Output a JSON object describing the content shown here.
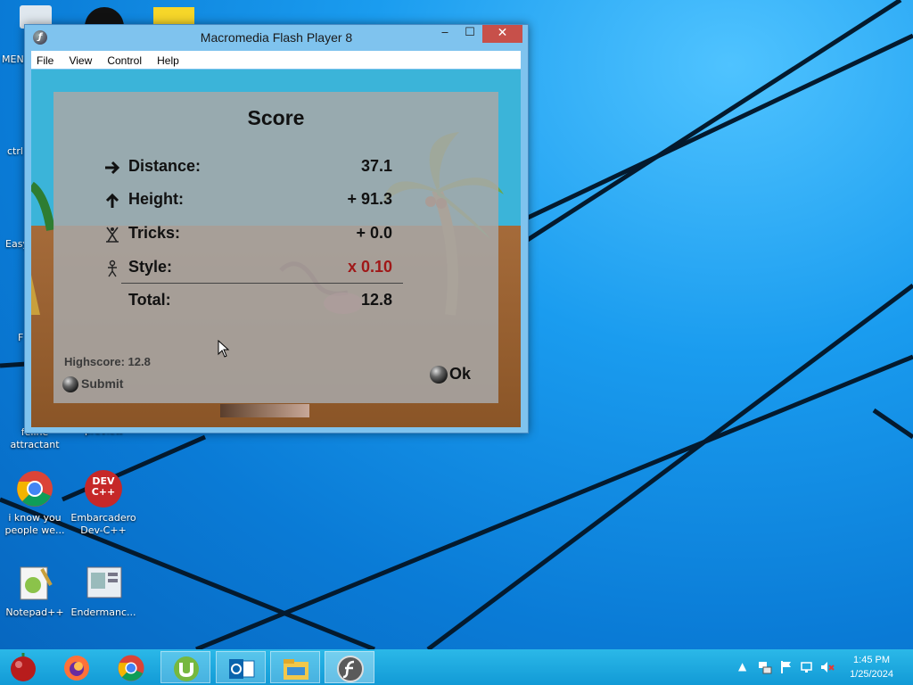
{
  "window": {
    "title": "Macromedia Flash Player 8",
    "menu": [
      "File",
      "View",
      "Control",
      "Help"
    ]
  },
  "score": {
    "title": "Score",
    "rows": [
      {
        "label": "Distance:",
        "value": "37.1"
      },
      {
        "label": "Height:",
        "value": "+ 91.3"
      },
      {
        "label": "Tricks:",
        "value": "+ 0.0"
      },
      {
        "label": "Style:",
        "value": "x 0.10"
      },
      {
        "label": "Total:",
        "value": "12.8"
      }
    ],
    "highscore": "Highscore: 12.8",
    "submit_label": "Submit",
    "ok_label": "Ok"
  },
  "desktop": {
    "icons": [
      {
        "label": "i know you people we..."
      },
      {
        "label": "Embarcadero Dev-C++"
      },
      {
        "label": "Notepad++"
      },
      {
        "label": "Endermanc..."
      },
      {
        "label": "feline attractant"
      }
    ],
    "partial_labels": [
      "MEN",
      "ctrl",
      "Easy",
      "F",
      "preview"
    ],
    "dev_icon_text": "DEV C++"
  },
  "taskbar": {
    "time": "1:45 PM",
    "date": "1/25/2024"
  },
  "colors": {
    "style_value": "#a01818",
    "close_button": "#c7504a",
    "taskbar": "#1ba6e0"
  }
}
